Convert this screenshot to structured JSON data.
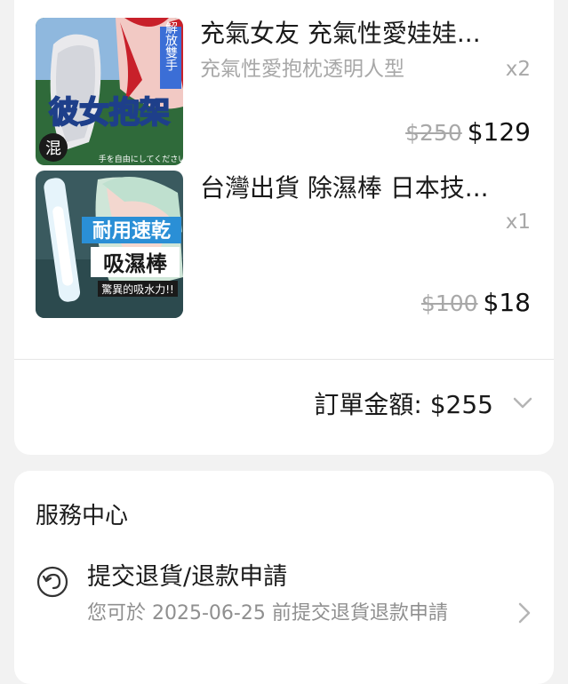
{
  "order": {
    "items": [
      {
        "title": "充氣女友 充氣性愛娃娃...",
        "variant": "充氣性愛抱枕透明人型",
        "quantity": "x2",
        "original_price": "$250",
        "price": "$129",
        "thumb_text": "彼女抱架",
        "thumb_side_text": "解放雙手",
        "thumb_badge": "混",
        "thumb_caption": "手を自由にしてください"
      },
      {
        "title": "台灣出貨 除濕棒 日本技...",
        "variant": "",
        "quantity": "x1",
        "original_price": "$100",
        "price": "$18",
        "thumb_text_1": "耐用速乾",
        "thumb_text_2": "吸濕棒",
        "thumb_caption": "驚異的吸水力!!"
      }
    ],
    "total_label": "訂單金額: $255"
  },
  "service": {
    "title": "服務中心",
    "refund_title": "提交退貨/退款申請",
    "refund_desc": "您可於 2025-06-25 前提交退貨退款申請"
  },
  "icons": {
    "expand": "chevron-down-icon",
    "refund": "undo-icon",
    "open": "chevron-right-icon"
  }
}
